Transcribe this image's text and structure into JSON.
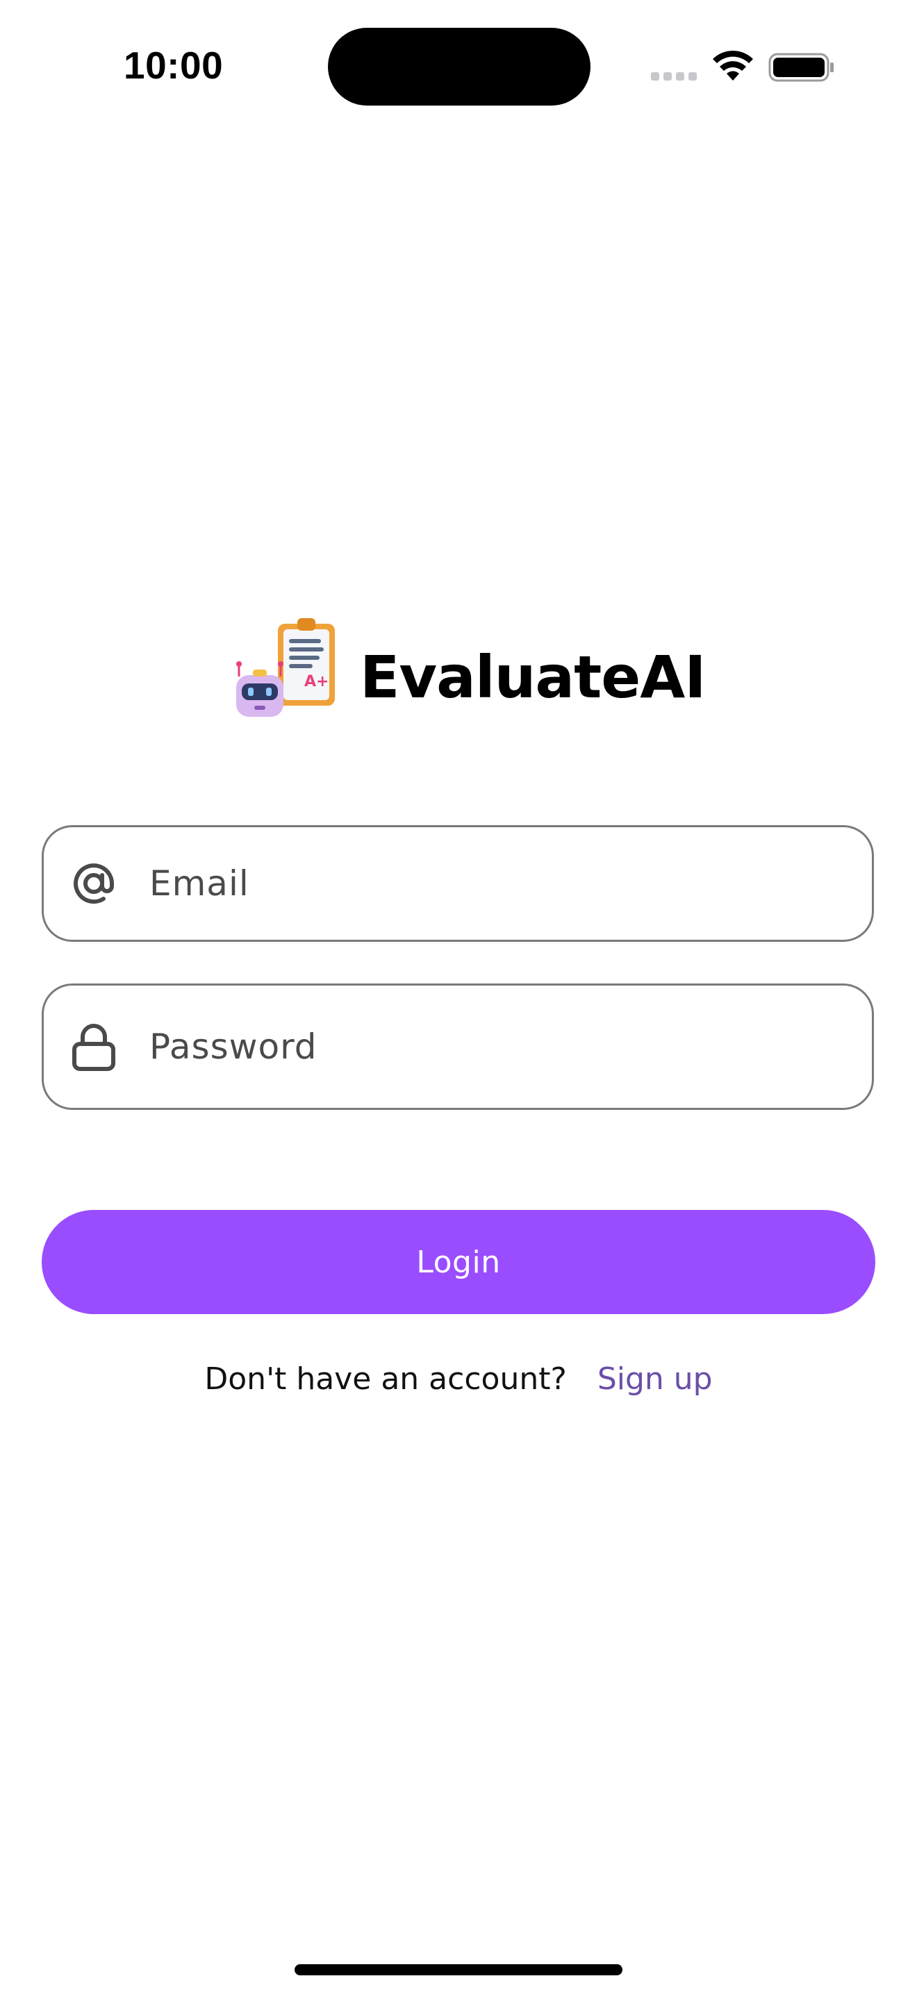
{
  "status_bar": {
    "time": "10:00",
    "icons": [
      "cellular-signal-icon",
      "wifi-icon",
      "battery-icon"
    ]
  },
  "logo": {
    "icon": "robot-clipboard-icon",
    "title": "EvaluateAI"
  },
  "form": {
    "email": {
      "icon": "at-sign-icon",
      "placeholder": "Email",
      "value": ""
    },
    "password": {
      "icon": "lock-icon",
      "placeholder": "Password",
      "value": ""
    },
    "login_label": "Login"
  },
  "signup": {
    "prompt": "Don't have an account?",
    "link_label": "Sign up"
  },
  "colors": {
    "accent": "#9a4dff",
    "link": "#6b4ea8",
    "field_border": "#7a7a7a"
  }
}
